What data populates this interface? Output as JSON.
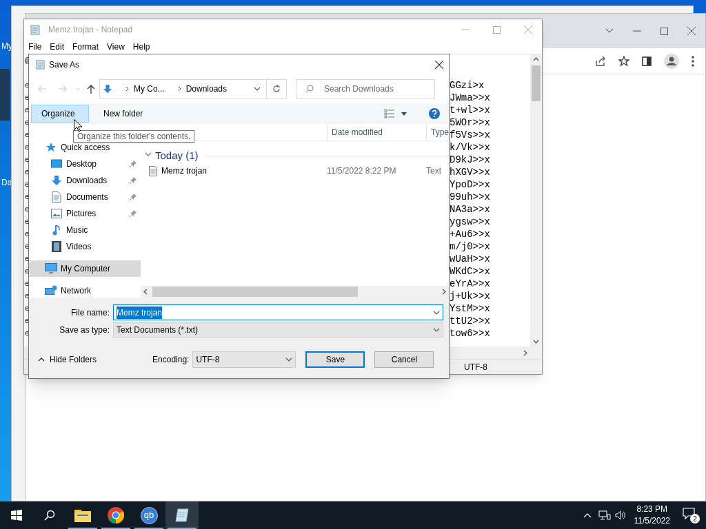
{
  "desktop": {
    "icon_labels": [
      "My",
      "Da"
    ]
  },
  "notepad": {
    "title": "Memz trojan - Notepad",
    "menu": [
      "File",
      "Edit",
      "Format",
      "View",
      "Help"
    ],
    "lines": [
      {
        "left": "@"
      },
      {
        "left": "e",
        "right": "GGzi>x"
      },
      {
        "left": "e",
        "right": "JWma>>x"
      },
      {
        "left": "e",
        "right": "t+wl>>x"
      },
      {
        "left": "e",
        "right": "5WOr>>x"
      },
      {
        "left": "e",
        "right": "f5Vs>>x"
      },
      {
        "left": "e",
        "right": "k/Vk>>x"
      },
      {
        "left": "e",
        "right": "D9kJ>>x"
      },
      {
        "left": "e",
        "right": "hXGV>>x"
      },
      {
        "left": "e",
        "right": "YpoD>>x"
      },
      {
        "left": "e",
        "right": "99uh>>x"
      },
      {
        "left": "e",
        "right": "NA3a>>x"
      },
      {
        "left": "e",
        "right": "ygsw>>x"
      },
      {
        "left": "e",
        "right": "+Au6>>x"
      },
      {
        "left": "e",
        "right": "m/j0>>x"
      },
      {
        "left": "e",
        "right": "wUaH>>x"
      },
      {
        "left": "e",
        "right": "WKdC>>x"
      },
      {
        "left": "e",
        "right": "eYrA>>x"
      },
      {
        "left": "e",
        "right": "j+Uk>>x"
      },
      {
        "left": "e",
        "right": "YstM>>x"
      },
      {
        "left": "e",
        "right": "ttU2>>x"
      },
      {
        "left": "e",
        "right": "tow6>>x"
      }
    ],
    "status": "UTF-8"
  },
  "dialog": {
    "title": "Save As",
    "breadcrumb": [
      "My Co...",
      "Downloads"
    ],
    "search_placeholder": "Search Downloads",
    "toolbar": [
      {
        "label": "Organize",
        "kind": "menu",
        "hovered": true
      },
      {
        "label": "New folder",
        "kind": "button",
        "hovered": false
      }
    ],
    "columns": [
      "Date modified",
      "Type"
    ],
    "nav": [
      {
        "label": "Quick access",
        "kind": "star",
        "selected": false,
        "children": [
          {
            "label": "Desktop",
            "kind": "desktop",
            "pinned": true,
            "selected": false
          },
          {
            "label": "Downloads",
            "kind": "download",
            "pinned": true,
            "selected": false
          },
          {
            "label": "Documents",
            "kind": "document",
            "pinned": true,
            "selected": false
          },
          {
            "label": "Pictures",
            "kind": "pictures",
            "pinned": true,
            "selected": false
          },
          {
            "label": "Music",
            "kind": "music",
            "pinned": false,
            "selected": false
          },
          {
            "label": "Videos",
            "kind": "videos",
            "pinned": false,
            "selected": false
          }
        ]
      },
      {
        "label": "My Computer",
        "kind": "computer",
        "selected": true
      },
      {
        "label": "Network",
        "kind": "network",
        "selected": false
      }
    ],
    "groups": [
      {
        "label": "Today (1)",
        "expanded": true,
        "files": [
          {
            "name": "Memz trojan",
            "date": "11/5/2022 8:22 PM",
            "type": "Text"
          }
        ]
      }
    ],
    "file_name": {
      "label": "File name:",
      "value": "Memz trojan"
    },
    "save_type": {
      "label": "Save as type:",
      "value": "Text Documents (*.txt)"
    },
    "hide_folders": "Hide Folders",
    "encoding": {
      "label": "Encoding:",
      "value": "UTF-8"
    },
    "buttons": [
      {
        "label": "Save",
        "default": true
      },
      {
        "label": "Cancel",
        "default": false
      }
    ],
    "tooltip": "Organize this folder's contents."
  },
  "taskbar": {
    "apps": [
      {
        "kind": "explorer",
        "running": true,
        "active": false
      },
      {
        "kind": "browser",
        "running": true,
        "active": false
      },
      {
        "kind": "qb",
        "label": "qb",
        "running": true,
        "active": false
      },
      {
        "kind": "notepad",
        "running": true,
        "active": true
      }
    ],
    "time": "8:23 PM",
    "date": "11/5/2022",
    "notifications": "2"
  }
}
